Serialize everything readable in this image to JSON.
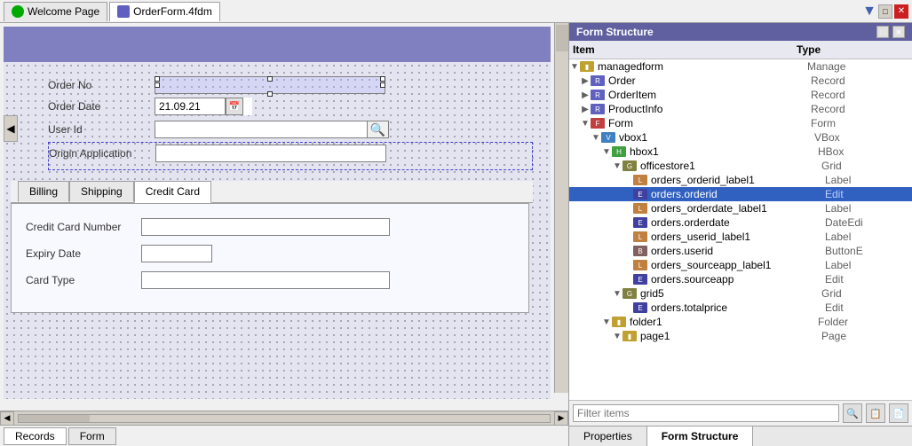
{
  "tabs": {
    "welcome": "Welcome Page",
    "orderform": "OrderForm.4fdm"
  },
  "form": {
    "fields": {
      "order_no_label": "Order No",
      "order_date_label": "Order Date",
      "order_date_value": "21.09.21",
      "user_id_label": "User Id",
      "origin_app_label": "Origin Application"
    },
    "sub_tabs": [
      "Billing",
      "Shipping",
      "Credit Card"
    ],
    "active_sub_tab": "Credit Card",
    "credit_card": {
      "number_label": "Credit Card Number",
      "expiry_label": "Expiry Date",
      "type_label": "Card Type"
    }
  },
  "bottom_tabs": [
    "Records",
    "Form"
  ],
  "structure_panel": {
    "title": "Form Structure",
    "header": {
      "item": "Item",
      "type": "Type"
    },
    "filter_placeholder": "Filter items",
    "bottom_tabs": [
      "Properties",
      "Form Structure"
    ],
    "active_bottom_tab": "Form Structure",
    "tree": [
      {
        "level": 0,
        "indent": 0,
        "toggle": "▼",
        "icon": "folder",
        "name": "managedform",
        "type": "Manage",
        "selected": false
      },
      {
        "level": 1,
        "indent": 1,
        "toggle": "▶",
        "icon": "record",
        "name": "Order",
        "type": "Record",
        "selected": false
      },
      {
        "level": 1,
        "indent": 1,
        "toggle": "▶",
        "icon": "record",
        "name": "OrderItem",
        "type": "Record",
        "selected": false
      },
      {
        "level": 1,
        "indent": 1,
        "toggle": "▶",
        "icon": "record",
        "name": "ProductInfo",
        "type": "Record",
        "selected": false
      },
      {
        "level": 1,
        "indent": 1,
        "toggle": "▼",
        "icon": "form",
        "name": "Form",
        "type": "Form",
        "selected": false
      },
      {
        "level": 2,
        "indent": 2,
        "toggle": "▼",
        "icon": "vbox",
        "name": "vbox1",
        "type": "VBox",
        "selected": false
      },
      {
        "level": 3,
        "indent": 3,
        "toggle": "▼",
        "icon": "hbox",
        "name": "hbox1",
        "type": "HBox",
        "selected": false
      },
      {
        "level": 4,
        "indent": 4,
        "toggle": "▼",
        "icon": "grid",
        "name": "officestore1",
        "type": "Grid",
        "selected": false
      },
      {
        "level": 5,
        "indent": 5,
        "toggle": " ",
        "icon": "label",
        "name": "orders_orderid_label1",
        "type": "Label",
        "selected": false
      },
      {
        "level": 5,
        "indent": 5,
        "toggle": " ",
        "icon": "edit",
        "name": "orders.orderid",
        "type": "Edit",
        "selected": true
      },
      {
        "level": 5,
        "indent": 5,
        "toggle": " ",
        "icon": "label",
        "name": "orders_orderdate_label1",
        "type": "Label",
        "selected": false
      },
      {
        "level": 5,
        "indent": 5,
        "toggle": " ",
        "icon": "edit",
        "name": "orders.orderdate",
        "type": "DateEdi",
        "selected": false
      },
      {
        "level": 5,
        "indent": 5,
        "toggle": " ",
        "icon": "label",
        "name": "orders_userid_label1",
        "type": "Label",
        "selected": false
      },
      {
        "level": 5,
        "indent": 5,
        "toggle": " ",
        "icon": "btn",
        "name": "orders.userid",
        "type": "ButtonE",
        "selected": false
      },
      {
        "level": 5,
        "indent": 5,
        "toggle": " ",
        "icon": "label",
        "name": "orders_sourceapp_label1",
        "type": "Label",
        "selected": false
      },
      {
        "level": 5,
        "indent": 5,
        "toggle": " ",
        "icon": "edit",
        "name": "orders.sourceapp",
        "type": "Edit",
        "selected": false
      },
      {
        "level": 4,
        "indent": 4,
        "toggle": "▼",
        "icon": "grid",
        "name": "grid5",
        "type": "Grid",
        "selected": false
      },
      {
        "level": 5,
        "indent": 5,
        "toggle": " ",
        "icon": "edit",
        "name": "orders.totalprice",
        "type": "Edit",
        "selected": false
      },
      {
        "level": 3,
        "indent": 3,
        "toggle": "▼",
        "icon": "folder",
        "name": "folder1",
        "type": "Folder",
        "selected": false
      },
      {
        "level": 4,
        "indent": 4,
        "toggle": "▼",
        "icon": "folder",
        "name": "page1",
        "type": "Page",
        "selected": false
      }
    ]
  }
}
